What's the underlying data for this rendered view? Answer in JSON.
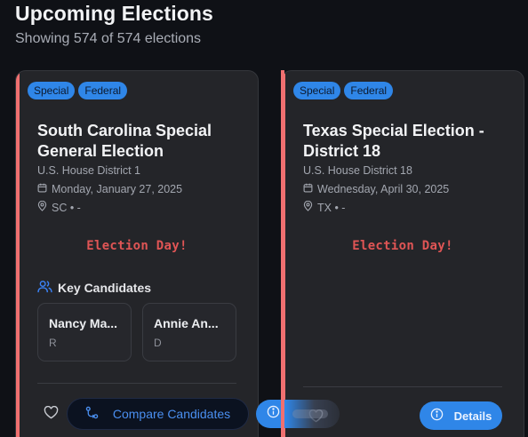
{
  "header": {
    "title": "Upcoming Elections",
    "subtitle": "Showing 574 of 574 elections"
  },
  "colors": {
    "background": "#0f1116",
    "card": "#242529",
    "accent_stripe": "#f07070",
    "tag": "#2f86e8",
    "election_day": "#e05555",
    "primary_button": "#2f86e8",
    "compare_text": "#4a8ff0"
  },
  "cards": [
    {
      "tags": [
        "Special",
        "Federal"
      ],
      "title": "South Carolina Special General Election",
      "district": "U.S. House District 1",
      "date": "Monday, January 27, 2025",
      "location": "SC • -",
      "status": "Election Day!",
      "key_candidates_label": "Key Candidates",
      "candidates": [
        {
          "name": "Nancy Ma...",
          "party": "R"
        },
        {
          "name": "Annie An...",
          "party": "D"
        }
      ],
      "compare_label": "Compare Candidates",
      "icons": [
        "calendar-icon",
        "map-pin-icon",
        "users-icon",
        "heart-icon",
        "compare-icon"
      ]
    },
    {
      "tags": [
        "Special",
        "Federal"
      ],
      "title": "Texas Special Election - District 18",
      "district": "U.S. House District 18",
      "date": "Wednesday, April 30, 2025",
      "location": "TX • -",
      "status": "Election Day!",
      "details_label": "Details",
      "icons": [
        "calendar-icon",
        "map-pin-icon",
        "heart-icon",
        "info-icon"
      ]
    }
  ]
}
